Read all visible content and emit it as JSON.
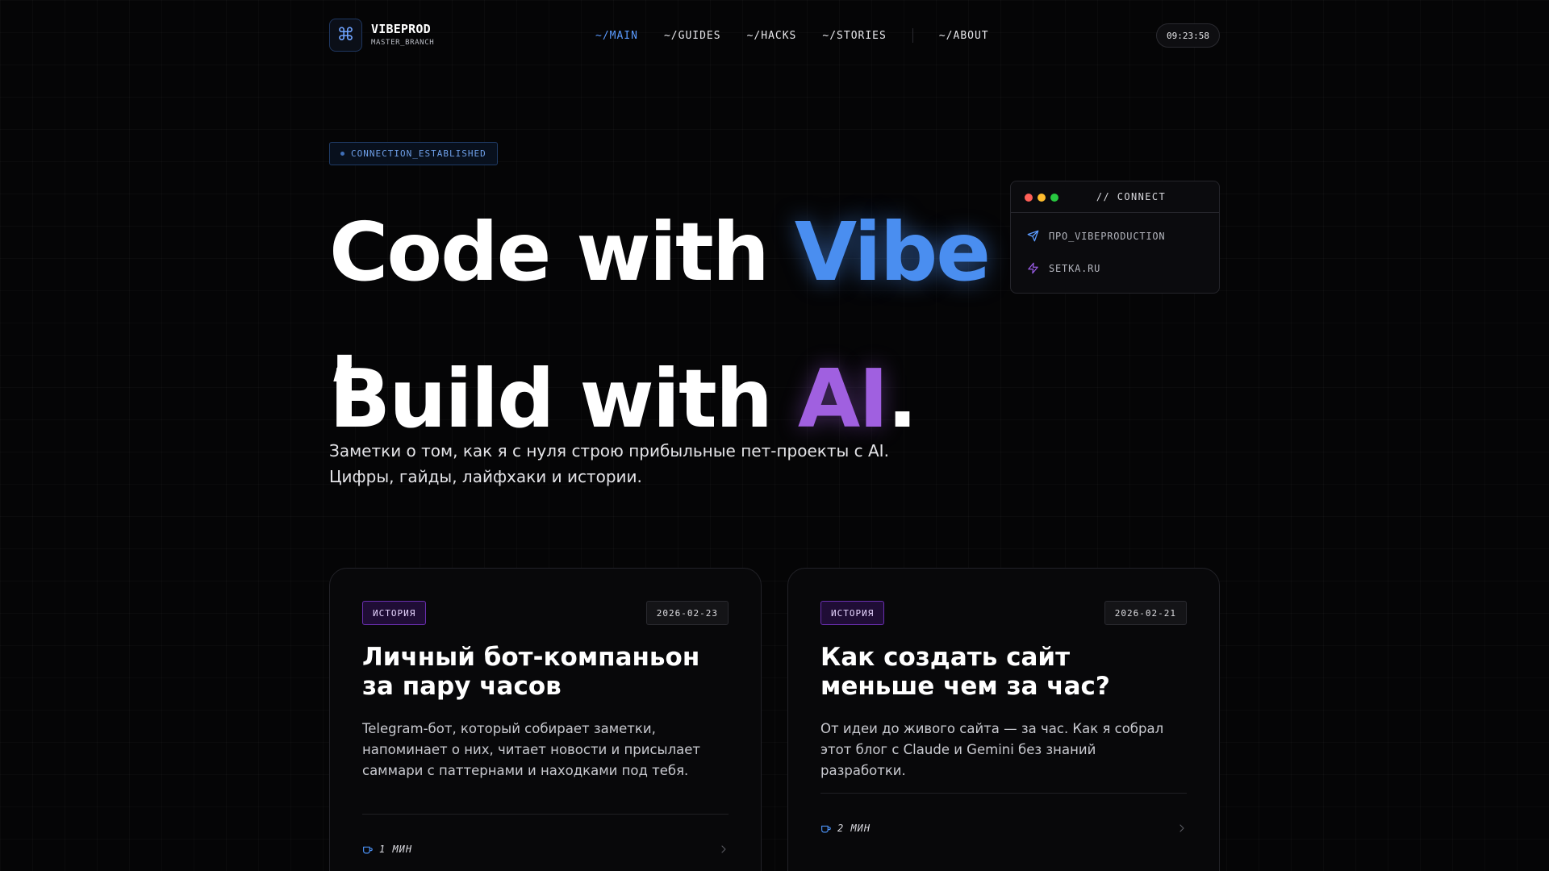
{
  "brand": {
    "logo_glyph": "⌘",
    "title": "VIBEPROD",
    "subtitle": "MASTER_BRANCH"
  },
  "nav": {
    "items": [
      {
        "label": "~/MAIN",
        "active": true
      },
      {
        "label": "~/GUIDES",
        "active": false
      },
      {
        "label": "~/HACKS",
        "active": false
      },
      {
        "label": "~/STORIES",
        "active": false
      },
      {
        "label": "~/ABOUT",
        "active": false
      }
    ]
  },
  "clock": "09:23:58",
  "status_badge": "CONNECTION_ESTABLISHED",
  "hero": {
    "line1_pre": "Code with ",
    "line1_accent": "Vibe",
    "comma": ",",
    "line2_pre": "Build with ",
    "line2_accent": "AI",
    "line2_post": ".",
    "subtitle_line1": "Заметки о том, как я с нуля строю прибыльные пет-проекты с AI.",
    "subtitle_line2": "Цифры, гайды, лайфхаки и истории."
  },
  "connect": {
    "title": "// CONNECT",
    "links": [
      {
        "label": "ПРО_VIBEPRODUCTION",
        "icon": "send-icon"
      },
      {
        "label": "SETKA.RU",
        "icon": "lightning-icon"
      }
    ]
  },
  "cards": [
    {
      "tag": "ИСТОРИЯ",
      "date": "2026-02-23",
      "title": "Личный бот-компаньон за пару часов",
      "description": "Telegram-бот, который собирает заметки, напоминает о них, читает новости и присылает саммари с паттернами и находками под тебя.",
      "read_time": "1 МИН"
    },
    {
      "tag": "ИСТОРИЯ",
      "date": "2026-02-21",
      "title": "Как создать сайт меньше чем за час?",
      "description": "От идеи до живого сайта — за час. Как я собрал этот блог с Claude и Gemini без знаний разработки.",
      "read_time": "2 МИН"
    }
  ],
  "colors": {
    "accent_blue": "#4a8ef0",
    "accent_purple": "#a060e0",
    "background": "#050506"
  }
}
